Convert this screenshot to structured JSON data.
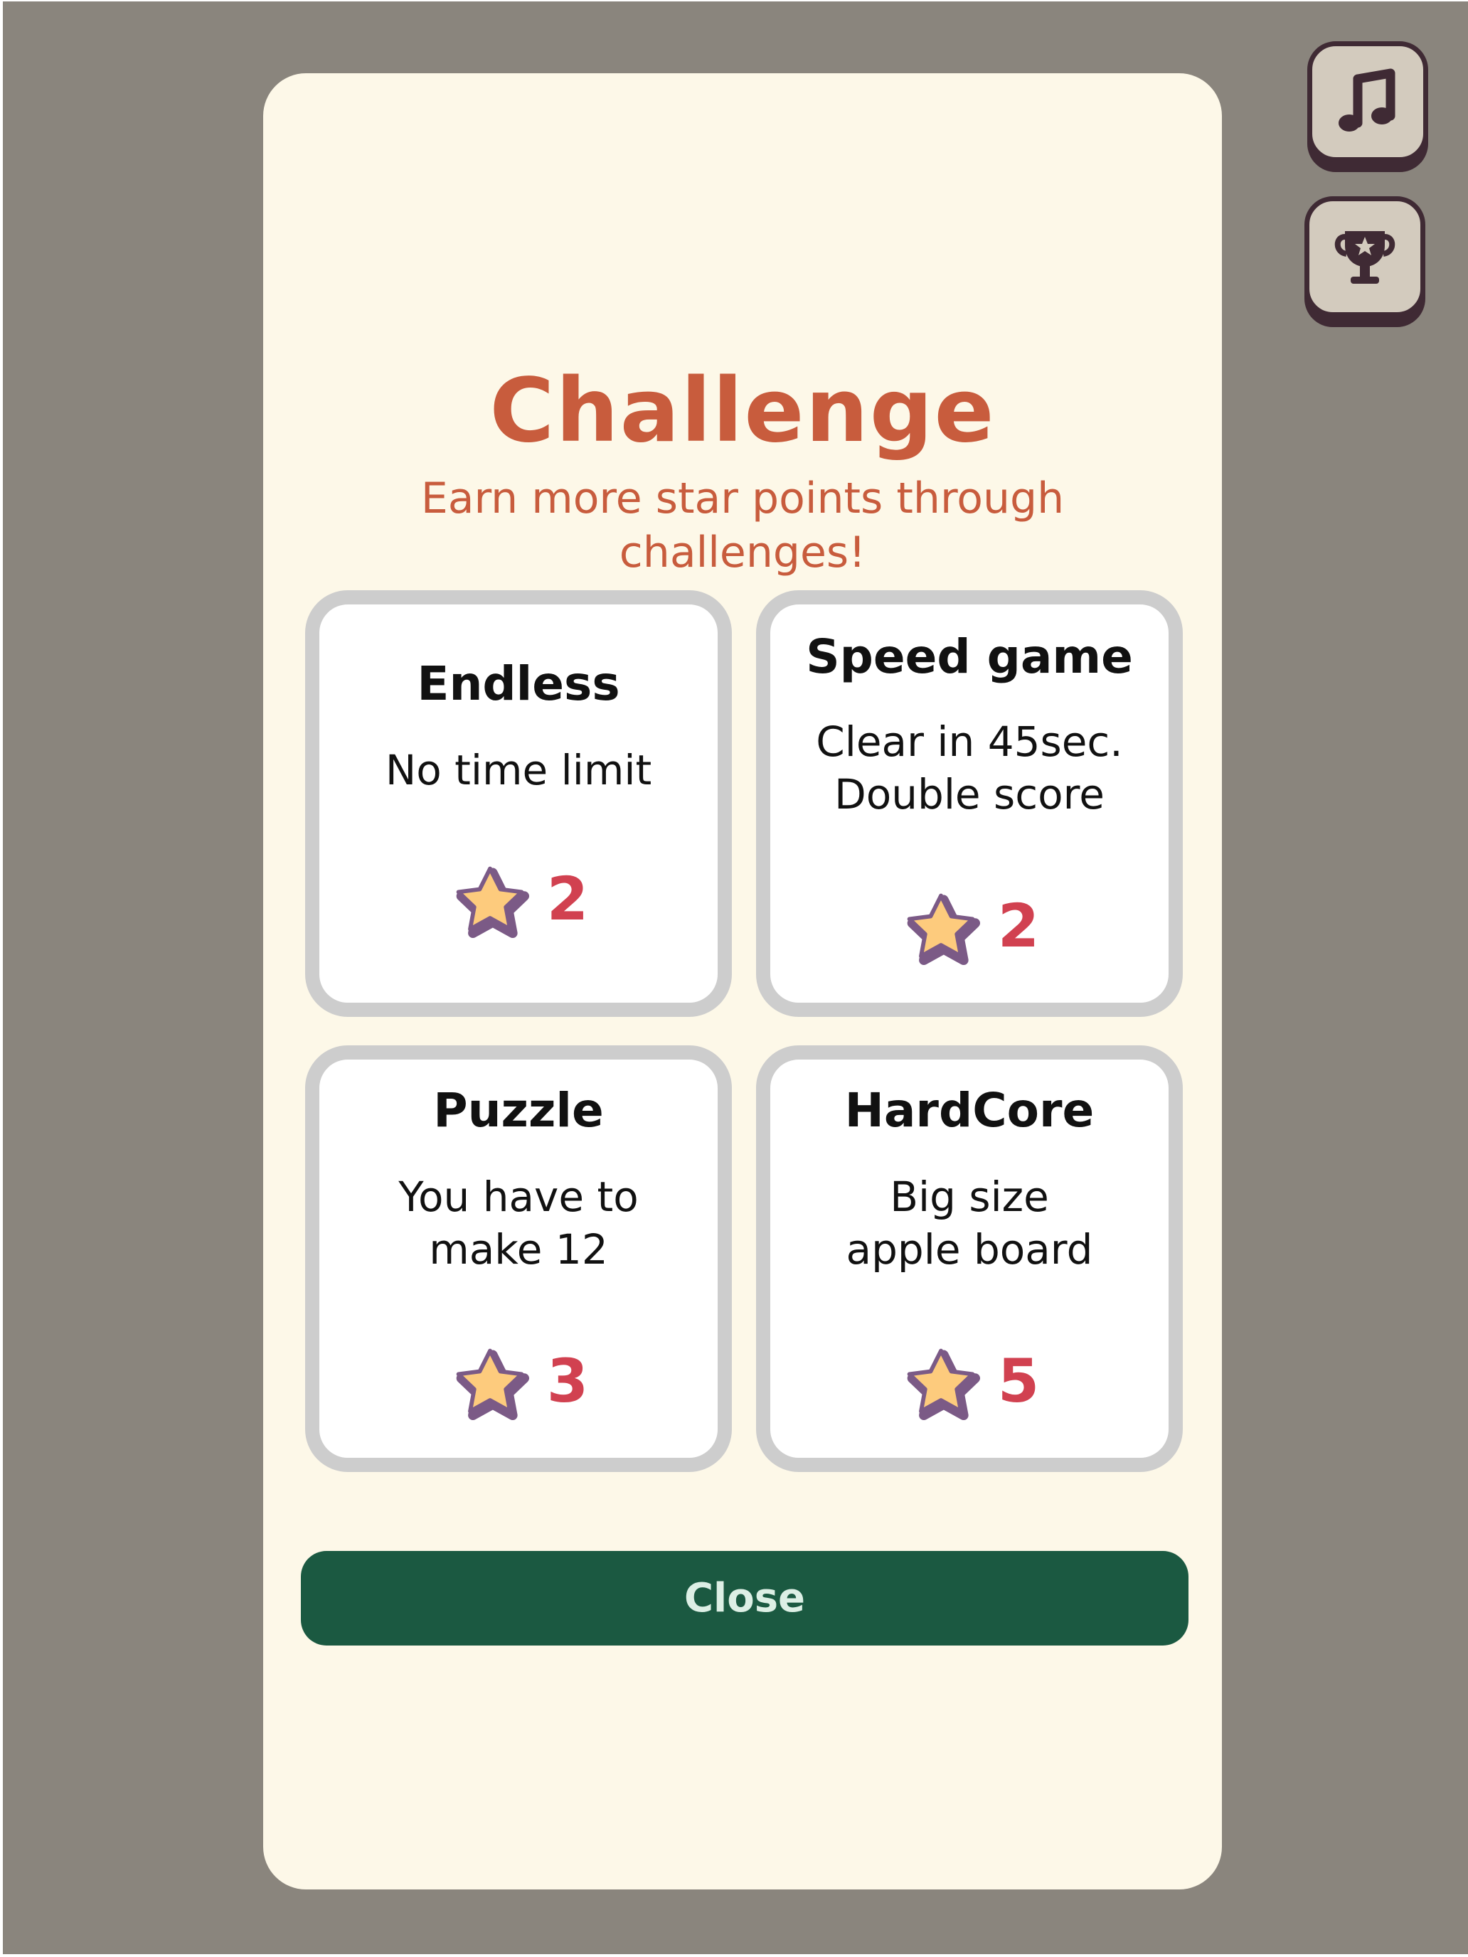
{
  "modal": {
    "title": "Challenge",
    "subtitle": "Earn more star points through\nchallenges!",
    "close_label": "Close"
  },
  "side_buttons": [
    {
      "name": "music",
      "icon": "music-note-icon"
    },
    {
      "name": "leaderboard",
      "icon": "trophy-icon"
    }
  ],
  "challenges": [
    {
      "title": "Endless",
      "description": "No time limit",
      "reward": "2"
    },
    {
      "title": "Speed game",
      "description": "Clear in 45sec.\nDouble score",
      "reward": "2"
    },
    {
      "title": "Puzzle",
      "description": "You have to\nmake 12",
      "reward": "3"
    },
    {
      "title": "HardCore",
      "description": "Big size\napple board",
      "reward": "5"
    }
  ],
  "colors": {
    "backdrop": "#8a857d",
    "modal": "#fdf8e8",
    "accent": "#c85c3d",
    "reward": "#d14150",
    "close_button": "#1b5941",
    "star_fill": "#fdcb7d",
    "star_outline": "#7b5a86"
  }
}
